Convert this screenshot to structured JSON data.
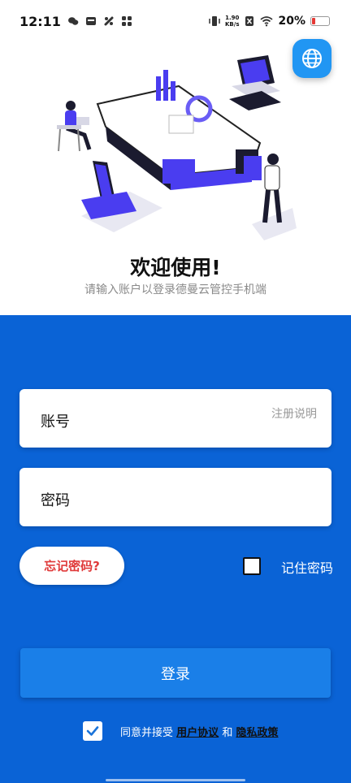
{
  "status_bar": {
    "time": "12:11",
    "net_speed_value": "1.90",
    "net_speed_unit": "KB/s",
    "battery": "20%",
    "battery_level": 0.2
  },
  "language_button": {
    "icon": "globe-icon"
  },
  "welcome": {
    "title": "欢迎使用!",
    "subtitle": "请输入账户以登录德曼云管控手机端"
  },
  "form": {
    "account_label": "账号",
    "register_link": "注册说明",
    "password_label": "密码",
    "forgot_label": "忘记密码?",
    "remember_label": "记住密码",
    "remember_checked": false,
    "login_label": "登录"
  },
  "agreement": {
    "checked": true,
    "prefix": "同意并接受",
    "user_agreement": "用户协议",
    "conjunction": "和",
    "privacy_policy": "隐私政策"
  },
  "colors": {
    "primary_blue": "#0a63d6",
    "button_blue": "#1a7fe8",
    "globe_button": "#2196f3",
    "forgot_red": "#e03a3a"
  }
}
